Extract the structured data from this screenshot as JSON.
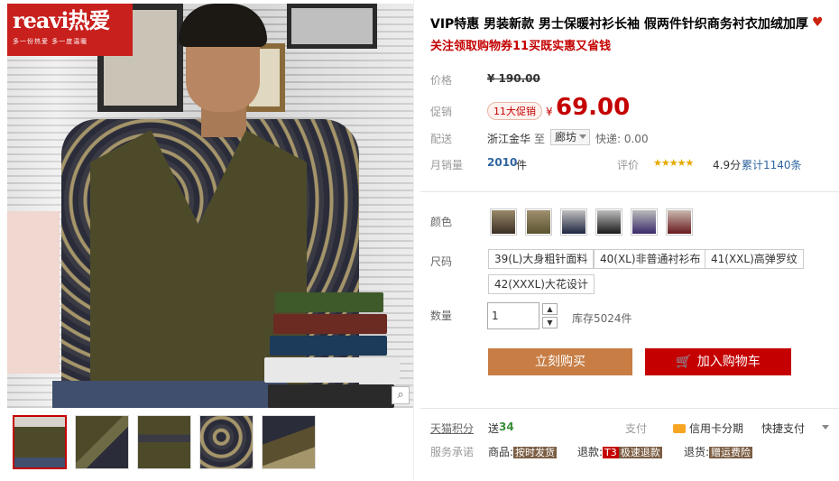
{
  "brand": {
    "logo_text": "reavi热爱",
    "logo_tagline": "多一份热爱 多一度温暖",
    "logo_color": "#c8201d"
  },
  "product": {
    "title": "VIP特惠 男装新款 男士保暖衬衫长袖 假两件针织商务衬衣加绒加厚",
    "subtitle": "关注领取购物券11买既实惠又省钱"
  },
  "price": {
    "label_price": "价格",
    "original": "¥ 190.00",
    "label_promo": "促销",
    "promo_tag": "11大促销",
    "currency": "¥",
    "promo_price": "69.00",
    "accent_color": "#c40000"
  },
  "delivery": {
    "label": "配送",
    "origin": "浙江金华",
    "to": "至",
    "destination": "廊坊",
    "shipping": "快递: 0.00"
  },
  "sales": {
    "label": "月销量",
    "count": "2010",
    "unit": "件",
    "rating_label": "评价",
    "stars": "★★★★★",
    "score": "4.9分",
    "reviews": "累计1140条"
  },
  "color": {
    "label": "颜色",
    "swatches": [
      "brown-shirt",
      "olive-vest",
      "navy-vest",
      "black-vest",
      "purple-vest",
      "burgundy-vest"
    ]
  },
  "size": {
    "label": "尺码",
    "options": [
      "39(L)大身粗针面料",
      "40(XL)非普通衬衫布",
      "41(XXL)高弹罗纹",
      "42(XXXL)大花设计"
    ]
  },
  "quantity": {
    "label": "数量",
    "value": "1",
    "stock": "库存5024件",
    "up": "▲",
    "down": "▼"
  },
  "actions": {
    "buy_now": "立刻购买",
    "add_to_cart": "加入购物车"
  },
  "footer": {
    "points_label": "天猫积分",
    "points_prefix": "送",
    "points_value": "34",
    "pay_label": "支付",
    "credit": "信用卡分期",
    "quick_pay": "快捷支付",
    "promise_label": "服务承诺",
    "goods_label": "商品:",
    "goods_tag": "按时发货",
    "refund_label": "退款:",
    "refund_badge": "T3",
    "refund_tag": "极速退款",
    "return_label": "退货:",
    "return_tag": "赠运费险"
  },
  "zoom_icon": "⌕"
}
